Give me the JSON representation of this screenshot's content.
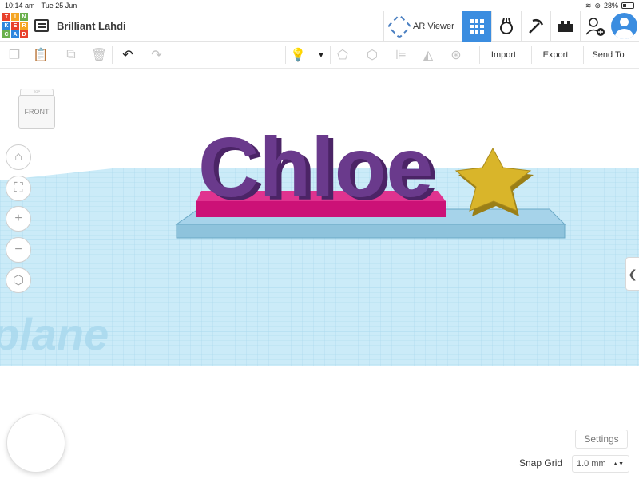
{
  "status": {
    "time": "10:14 am",
    "date": "Tue 25 Jun",
    "battery": "28%"
  },
  "logo": {
    "letters": [
      "T",
      "I",
      "N",
      "K",
      "E",
      "R",
      "C",
      "A",
      "D"
    ],
    "colors": [
      "#e8412c",
      "#f5a623",
      "#6ab04c",
      "#2e86de",
      "#e8412c",
      "#f5a623",
      "#6ab04c",
      "#2e86de",
      "#e8412c"
    ]
  },
  "header": {
    "title": "Brilliant Lahdi",
    "ar_viewer_label": "AR Viewer",
    "icons": [
      "list-icon",
      "ar-viewer-icon",
      "grid-view-icon",
      "blocks-view-icon",
      "bricks-view-icon",
      "add-user-icon",
      "user-avatar"
    ]
  },
  "toolbar": {
    "import_label": "Import",
    "export_label": "Export",
    "send_to_label": "Send To",
    "icons": [
      "copy-icon",
      "paste-icon",
      "duplicate-icon",
      "delete-icon",
      "undo-icon",
      "redo-icon",
      "light-icon",
      "dropdown-caret-icon",
      "group-icon",
      "ungroup-icon",
      "align-icon",
      "mirror-icon",
      "cruise-icon"
    ]
  },
  "viewcube": {
    "face_label": "FRONT",
    "top_label": "TOP"
  },
  "scene": {
    "text_object": "Chloe",
    "workplane_label": "plane",
    "colors": {
      "text": "#6a3a8c",
      "base": "#cc1177",
      "plate": "#8ec8e6",
      "star": "#d9b52a",
      "grid": "#b6e0f1"
    }
  },
  "nav_icons": [
    "home-icon",
    "fit-view-icon",
    "zoom-in-icon",
    "zoom-out-icon",
    "perspective-icon"
  ],
  "settings_label": "Settings",
  "snap_grid": {
    "label": "Snap Grid",
    "value": "1.0 mm"
  }
}
